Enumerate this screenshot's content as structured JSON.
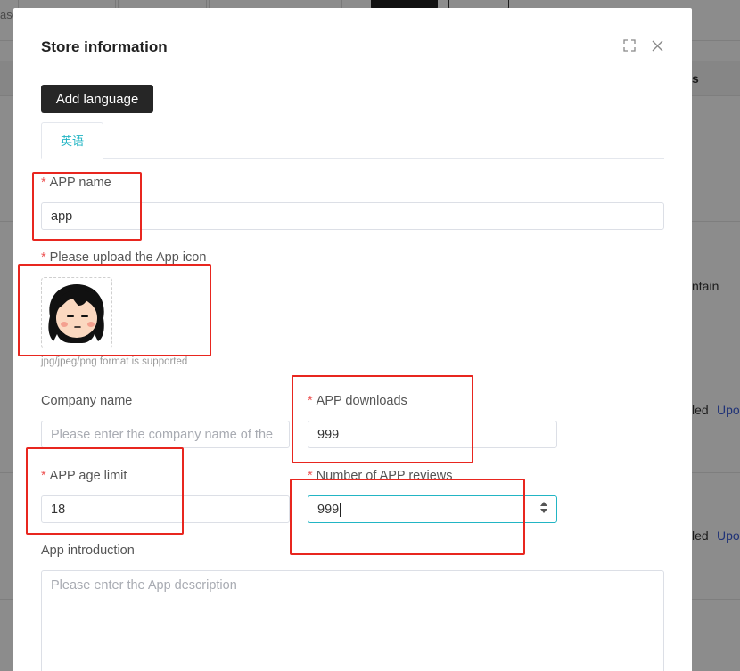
{
  "background": {
    "left_text": "ase",
    "header_right_text": "s",
    "row1_text": "ntain",
    "row2_status": "led",
    "row2_link": "Upo",
    "row3_status": "led",
    "row3_link": "Upo"
  },
  "modal": {
    "title": "Store information",
    "fullscreen_icon": "fullscreen-icon",
    "close_icon": "close-icon",
    "add_language_label": "Add language",
    "tabs": [
      {
        "label": "英语",
        "active": true
      }
    ]
  },
  "form": {
    "app_name": {
      "required": "*",
      "label": "APP name",
      "value": "app"
    },
    "app_icon": {
      "required": "*",
      "label": "Please upload the App icon",
      "hint": "jpg/jpeg/png format is supported"
    },
    "company_name": {
      "label": "Company name",
      "placeholder": "Please enter the company name of the"
    },
    "app_downloads": {
      "required": "*",
      "label": "APP downloads",
      "value": "999"
    },
    "app_age_limit": {
      "required": "*",
      "label": "APP age limit",
      "value": "18"
    },
    "app_reviews": {
      "required": "*",
      "label": "Number of APP reviews",
      "value": "999"
    },
    "app_intro": {
      "label": "App introduction",
      "placeholder": "Please enter the App description"
    }
  },
  "colors": {
    "accent": "#22b5c4",
    "required": "#e55555",
    "annotation": "#e8261f",
    "button_dark": "#262626"
  }
}
